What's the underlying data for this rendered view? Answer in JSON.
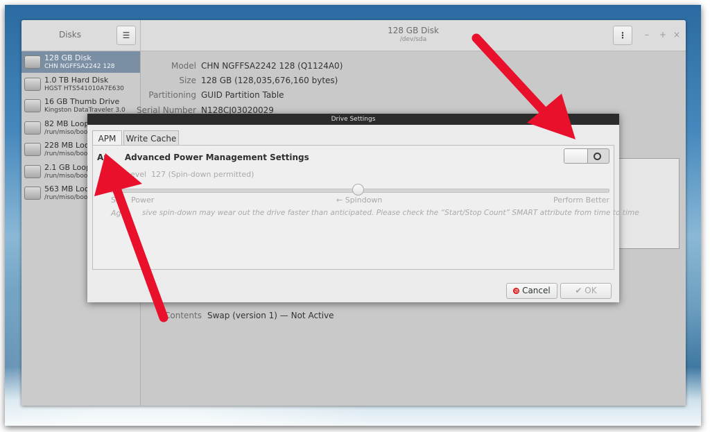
{
  "app": {
    "sidebar_title": "Disks",
    "disk_title": "128 GB Disk",
    "disk_path": "/dev/sda",
    "window_controls": [
      "–",
      "+",
      "×"
    ]
  },
  "devices": [
    {
      "name": "128 GB Disk",
      "sub": "CHN NGFFSA2242 128"
    },
    {
      "name": "1.0 TB Hard Disk",
      "sub": "HGST HTS541010A7E630"
    },
    {
      "name": "16 GB Thumb Drive",
      "sub": "Kingston DataTraveler 3.0"
    },
    {
      "name": "82 MB Loop",
      "sub": "/run/miso/boo"
    },
    {
      "name": "228 MB Loop",
      "sub": "/run/miso/boo"
    },
    {
      "name": "2.1 GB Loop",
      "sub": "/run/miso/boo"
    },
    {
      "name": "563 MB Loop",
      "sub": "/run/miso/boo"
    }
  ],
  "details": {
    "model_label": "Model",
    "model": "CHN NGFFSA2242 128 (Q1124A0)",
    "size_label": "Size",
    "size": "128 GB (128,035,676,160 bytes)",
    "partitioning_label": "Partitioning",
    "partitioning": "GUID Partition Table",
    "serial_label": "Serial Number",
    "serial": "N128CJ03020029",
    "contents_label": "Contents",
    "contents": "Swap (version 1) — Not Active"
  },
  "dialog": {
    "title": "Drive Settings",
    "tabs": [
      "APM",
      "Write Cache"
    ],
    "heading_a": "Ap",
    "heading_b": "Advanced Power Management Settings",
    "level_label": "evel",
    "level_value": "127 (Spin-down permitted)",
    "left_label": "Sa",
    "left_label_b": "Power",
    "mid_label": "← Spindown",
    "right_label": "Perform Better",
    "note_a": "Ag",
    "note_b": "sive spin-down may wear out the drive faster than anticipated. Please check the “Start/Stop Count” SMART attribute from time to time",
    "cancel": "Cancel",
    "ok": "OK",
    "apm_level": 127
  },
  "colors": {
    "accent_arrow": "#e8102a",
    "selected": "#7b8fa4"
  }
}
